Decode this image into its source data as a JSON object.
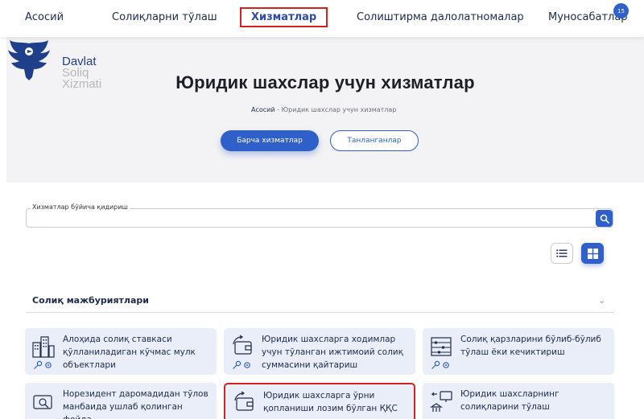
{
  "nav": {
    "items": [
      "Асосий",
      "Солиқларни тўлаш",
      "Хизматлар",
      "Солиштирма далолатномалар",
      "Муносабатлар"
    ],
    "badge": "15"
  },
  "logo": {
    "line1": "Davlat",
    "line2": "Soliq",
    "line3": "Xizmati"
  },
  "hero": {
    "title": "Юридик шахслар учун хизматлар",
    "breadcrumb_home": "Асосий",
    "breadcrumb_current": "- Юридик шахслар учун хизматлар",
    "btn_all": "Барча хизматлар",
    "btn_selected": "Танланганлар"
  },
  "search": {
    "label": "Хизматлар бўйича қидириш",
    "placeholder": ""
  },
  "section": {
    "title": "Солиқ мажбуриятлари"
  },
  "cards": [
    {
      "text": "Алоҳида солиқ ставкаси қўлланиладиган кўчмас мулк объектлари",
      "icon": "buildings-icon"
    },
    {
      "text": "Юридик шахсларга ходимлар учун тўланган ижтимоий солиқ суммасини қайтариш",
      "icon": "wallet-refund-icon"
    },
    {
      "text": "Солиқ қарзларини бўлиб-бўлиб тўлаш ёки кечиктириш",
      "icon": "abacus-icon"
    },
    {
      "text": "Норезидент даромадидан тўлов манбаида ушлаб қолинган фойда",
      "icon": "wallet-search-icon"
    },
    {
      "text": "Юридик шахсларга ўрни қопланиши лозим бўлган ҚҚС суммасини",
      "icon": "wallet-refund-icon"
    },
    {
      "text": "Юридик шахсларнинг солиқларини тўлаш",
      "icon": "bank-transfer-icon"
    }
  ],
  "colors": {
    "primary": "#2f5fc8",
    "highlight": "#d32020",
    "card_bg": "#e9eef8"
  }
}
